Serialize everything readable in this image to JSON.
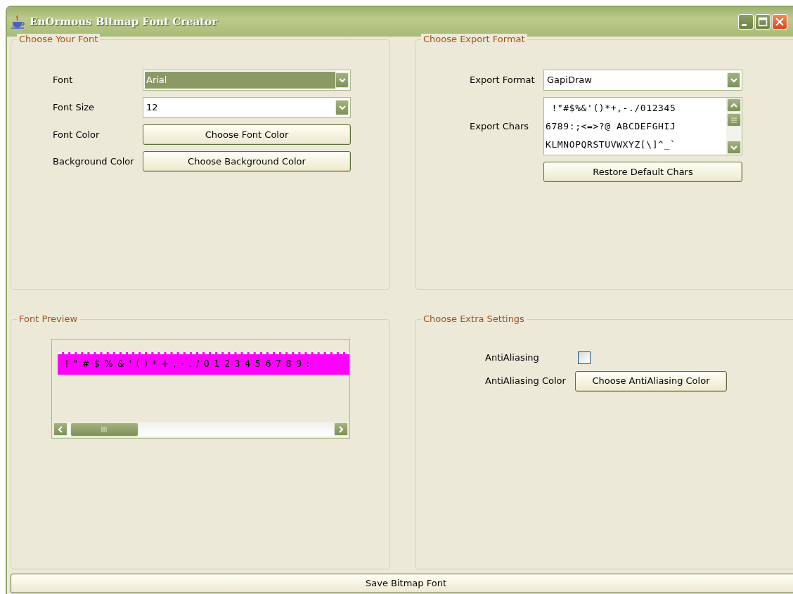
{
  "window": {
    "title": "EnOrmous Bitmap Font Creator"
  },
  "font_panel": {
    "title": "Choose Your Font",
    "font": {
      "label": "Font",
      "value": "Arial",
      "highlighted": true
    },
    "font_size": {
      "label": "Font Size",
      "value": "12",
      "highlighted": false
    },
    "font_color": {
      "label": "Font Color",
      "button": "Choose Font Color"
    },
    "background_color": {
      "label": "Background Color",
      "button": "Choose Background Color"
    }
  },
  "export_panel": {
    "title": "Choose Export Format",
    "format": {
      "label": "Export Format",
      "value": "GapiDraw",
      "highlighted": false
    },
    "chars": {
      "label": "Export Chars",
      "lines": [
        " !\"#$%&'()*+,-./012345",
        "6789:;<=>?@ ABCDEFGHIJ",
        "KLMNOPQRSTUVWXYZ[\\]^_`"
      ]
    },
    "restore_button": "Restore Default Chars"
  },
  "preview_panel": {
    "title": "Font Preview",
    "preview_text": " !\"#$%&'()*+,-./0123456789:"
  },
  "extra_panel": {
    "title": "Choose Extra Settings",
    "antialiasing": {
      "label": "AntiAliasing",
      "checked": false
    },
    "antialiasing_color": {
      "label": "AntiAliasing Color",
      "button": "Choose AntiAliasing Color"
    }
  },
  "save_button": "Save Bitmap Font"
}
